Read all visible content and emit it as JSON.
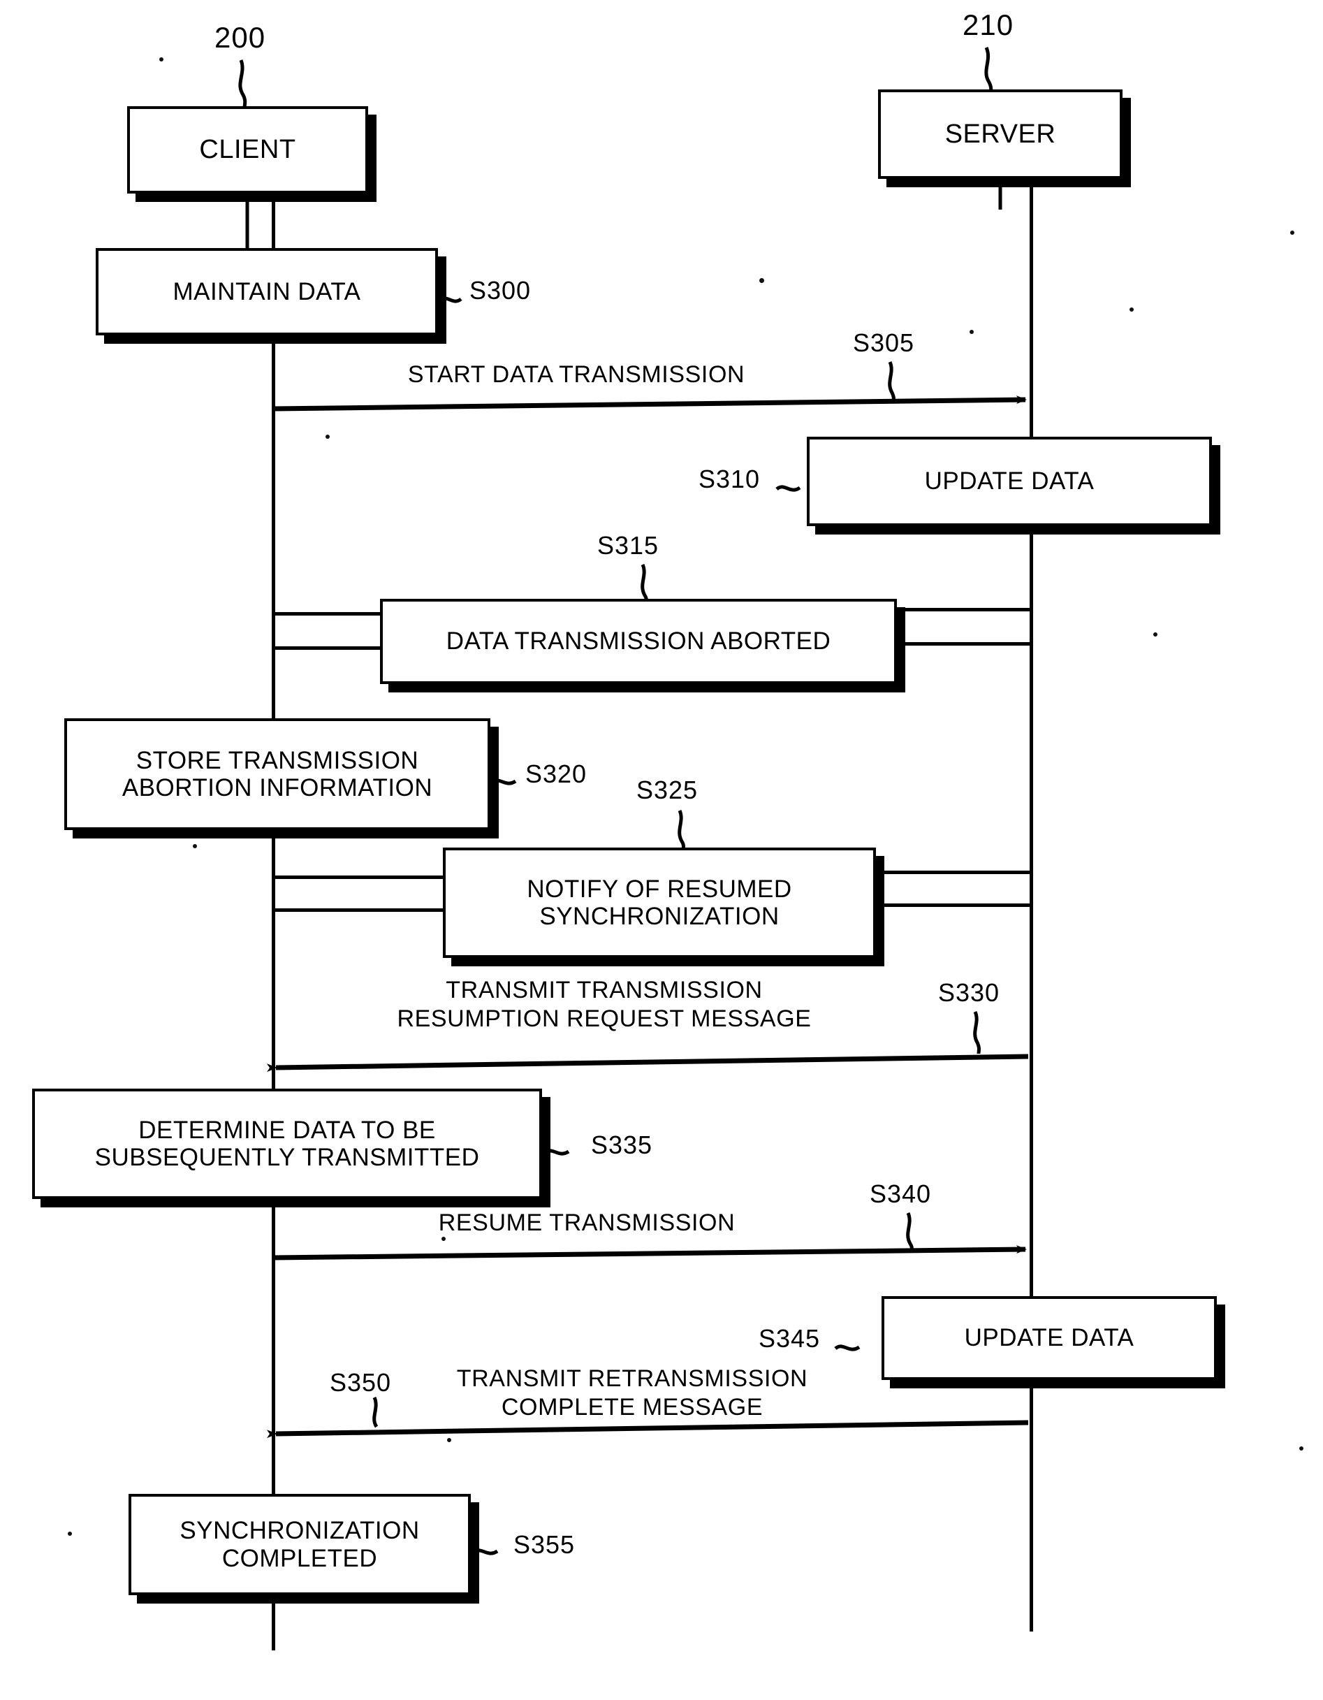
{
  "figure": {
    "type": "sequence-diagram",
    "background": "#ffffff",
    "ink": "#000000"
  },
  "actors": [
    {
      "id": "client",
      "label": "CLIENT",
      "ref": "200"
    },
    {
      "id": "server",
      "label": "SERVER",
      "ref": "210"
    }
  ],
  "steps": [
    {
      "id": "s300",
      "ref": "S300",
      "kind": "process",
      "lane": "client",
      "label": "MAINTAIN DATA"
    },
    {
      "id": "s305",
      "ref": "S305",
      "kind": "message",
      "from": "client",
      "to": "server",
      "label": "START DATA TRANSMISSION"
    },
    {
      "id": "s310",
      "ref": "S310",
      "kind": "process",
      "lane": "server",
      "label": "UPDATE DATA"
    },
    {
      "id": "s315",
      "ref": "S315",
      "kind": "message-box",
      "from": "client",
      "to": "server",
      "label": "DATA TRANSMISSION ABORTED"
    },
    {
      "id": "s320",
      "ref": "S320",
      "kind": "process",
      "lane": "client",
      "label": "STORE TRANSMISSION\nABORTION INFORMATION"
    },
    {
      "id": "s325",
      "ref": "S325",
      "kind": "message-box",
      "from": "client",
      "to": "server",
      "label": "NOTIFY OF RESUMED\nSYNCHRONIZATION"
    },
    {
      "id": "s330",
      "ref": "S330",
      "kind": "message",
      "from": "server",
      "to": "client",
      "label": "TRANSMIT TRANSMISSION\nRESUMPTION REQUEST MESSAGE"
    },
    {
      "id": "s335",
      "ref": "S335",
      "kind": "process",
      "lane": "client",
      "label": "DETERMINE DATA TO BE\nSUBSEQUENTLY TRANSMITTED"
    },
    {
      "id": "s340",
      "ref": "S340",
      "kind": "message",
      "from": "client",
      "to": "server",
      "label": "RESUME TRANSMISSION"
    },
    {
      "id": "s345",
      "ref": "S345",
      "kind": "process",
      "lane": "server",
      "label": "UPDATE DATA"
    },
    {
      "id": "s350",
      "ref": "S350",
      "kind": "message",
      "from": "server",
      "to": "client",
      "label": "TRANSMIT RETRANSMISSION\nCOMPLETE MESSAGE"
    },
    {
      "id": "s355",
      "ref": "S355",
      "kind": "process",
      "lane": "client",
      "label": "SYNCHRONIZATION\nCOMPLETED"
    }
  ]
}
